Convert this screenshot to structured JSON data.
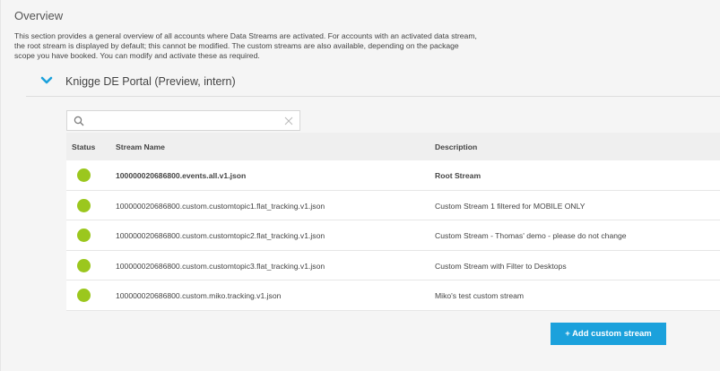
{
  "page": {
    "title": "Overview",
    "description": "This section provides a general overview of all accounts where Data Streams are activated. For accounts with an activated data stream, the root stream is displayed by default; this cannot be modified. The custom streams are also available, depending on the package scope you have booked. You can modify and activate these as required."
  },
  "account": {
    "name": "Knigge DE Portal (Preview, intern)",
    "expanded": true
  },
  "search": {
    "value": "",
    "placeholder": ""
  },
  "table": {
    "headers": {
      "status": "Status",
      "name": "Stream Name",
      "description": "Description"
    },
    "rows": [
      {
        "status": "active",
        "name": "100000020686800.events.all.v1.json",
        "description": "Root Stream",
        "bold": true
      },
      {
        "status": "active",
        "name": "100000020686800.custom.customtopic1.flat_tracking.v1.json",
        "description": "Custom Stream 1 filtered for MOBILE ONLY",
        "bold": false
      },
      {
        "status": "active",
        "name": "100000020686800.custom.customtopic2.flat_tracking.v1.json",
        "description": "Custom Stream - Thomas' demo - please do not change",
        "bold": false
      },
      {
        "status": "active",
        "name": "100000020686800.custom.customtopic3.flat_tracking.v1.json",
        "description": "Custom Stream with Filter to Desktops",
        "bold": false
      },
      {
        "status": "active",
        "name": "100000020686800.custom.miko.tracking.v1.json",
        "description": "Miko's test custom stream",
        "bold": false
      }
    ]
  },
  "actions": {
    "add_label": "+ Add custom stream"
  },
  "colors": {
    "accent": "#1ba1dc",
    "status_active": "#9bc71e",
    "chevron": "#1ba1dc"
  },
  "icons": {
    "chevron": "chevron-down-icon",
    "search": "search-icon",
    "clear": "close-icon",
    "status": "status-dot-icon"
  }
}
